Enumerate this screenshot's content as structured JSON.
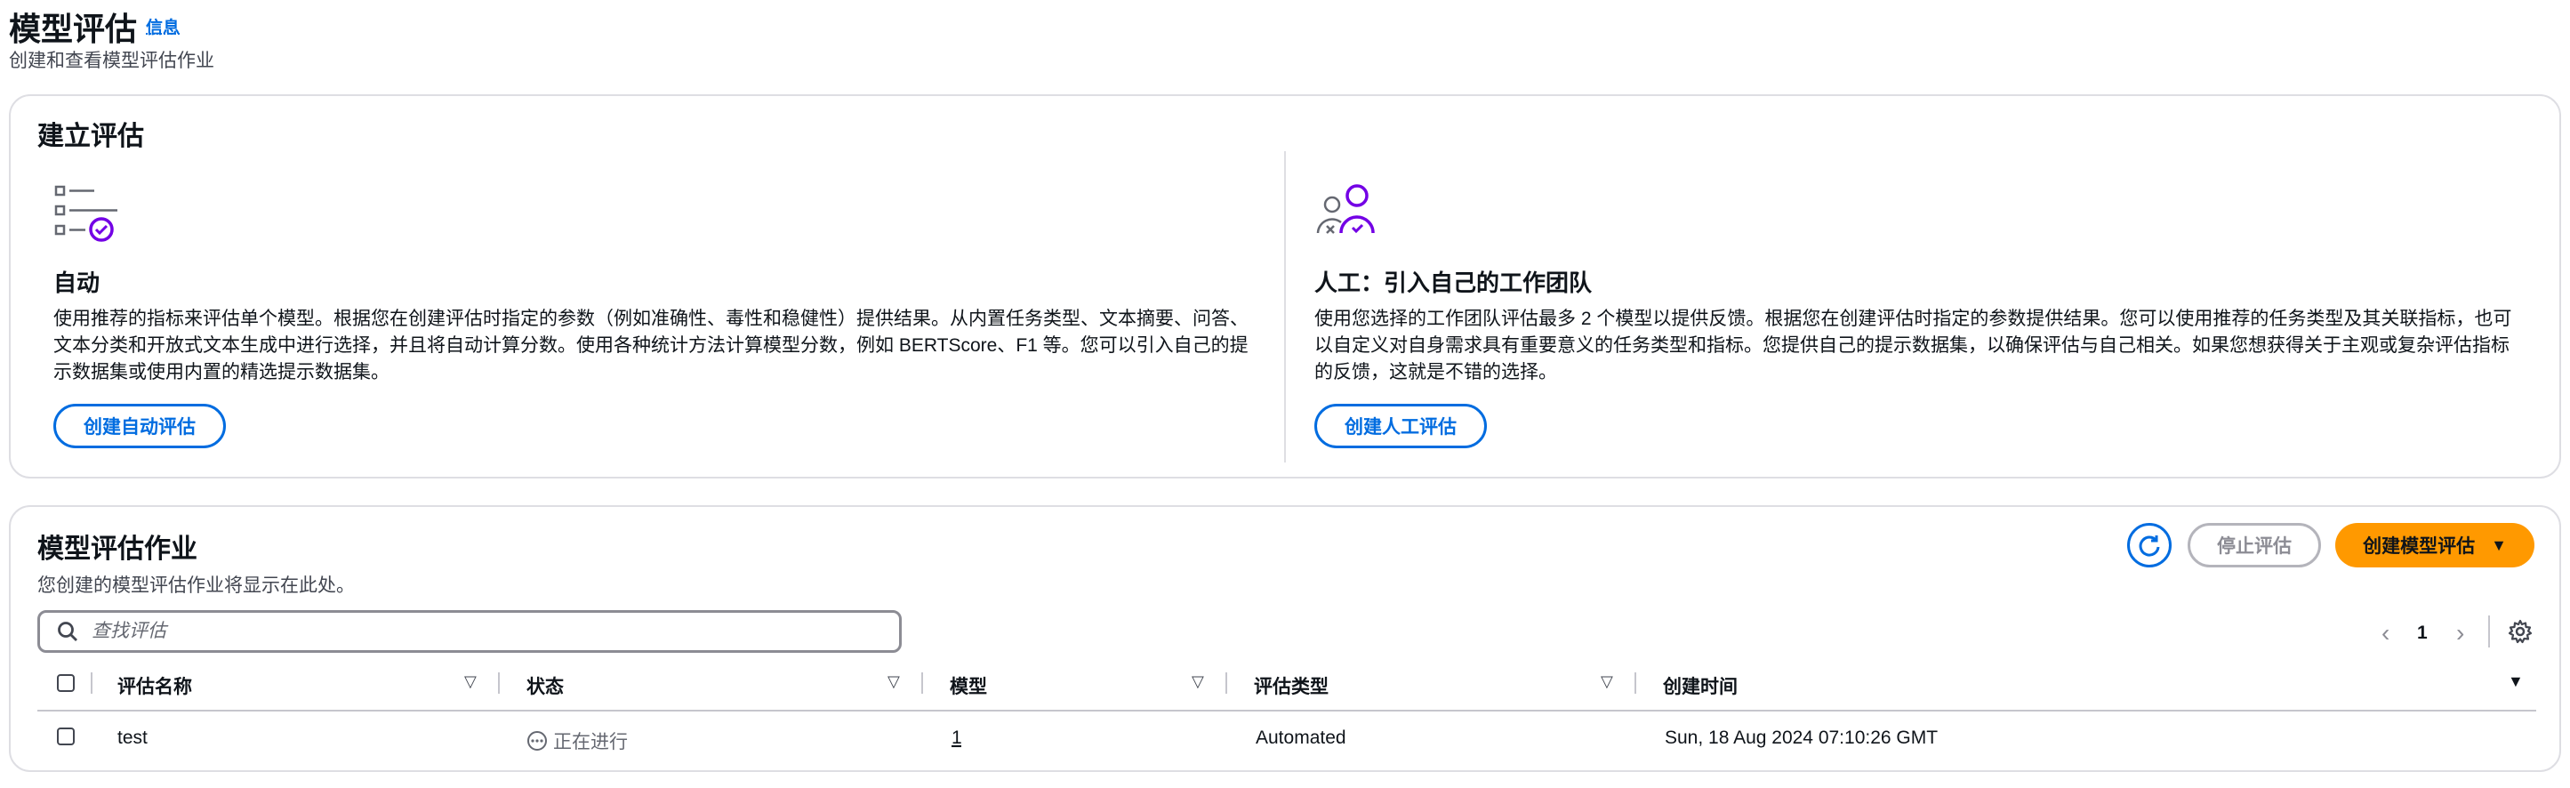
{
  "header": {
    "title": "模型评估",
    "info_link": "信息",
    "subtitle": "创建和查看模型评估作业"
  },
  "create_eval": {
    "title": "建立评估",
    "automatic": {
      "title": "自动",
      "description": "使用推荐的指标来评估单个模型。根据您在创建评估时指定的参数（例如准确性、毒性和稳健性）提供结果。从内置任务类型、文本摘要、问答、文本分类和开放式文本生成中进行选择，并且将自动计算分数。使用各种统计方法计算模型分数，例如 BERTScore、F1 等。您可以引入自己的提示数据集或使用内置的精选提示数据集。",
      "button_label": "创建自动评估",
      "icon": "checklist-icon"
    },
    "human": {
      "title": "人工：引入自己的工作团队",
      "description": "使用您选择的工作团队评估最多 2 个模型以提供反馈。根据您在创建评估时指定的参数提供结果。您可以使用推荐的任务类型及其关联指标，也可以自定义对自身需求具有重要意义的任务类型和指标。您提供自己的提示数据集，以确保评估与自己相关。如果您想获得关于主观或复杂评估指标的反馈，这就是不错的选择。",
      "button_label": "创建人工评估",
      "icon": "people-icon"
    }
  },
  "jobs": {
    "title": "模型评估作业",
    "subtitle": "您创建的模型评估作业将显示在此处。",
    "stop_button": "停止评估",
    "create_button": "创建模型评估",
    "search_placeholder": "查找评估",
    "pagination": {
      "current_page": "1"
    },
    "columns": [
      "评估名称",
      "状态",
      "模型",
      "评估类型",
      "创建时间"
    ],
    "rows": [
      {
        "name": "test",
        "status": "正在进行",
        "model": "1",
        "type": "Automated",
        "created": "Sun, 18 Aug 2024 07:10:26 GMT"
      }
    ]
  },
  "colors": {
    "link_blue": "#006ce0",
    "primary_orange": "#ff9900",
    "border_gray": "#dedee3",
    "icon_purple": "#7300e5"
  }
}
